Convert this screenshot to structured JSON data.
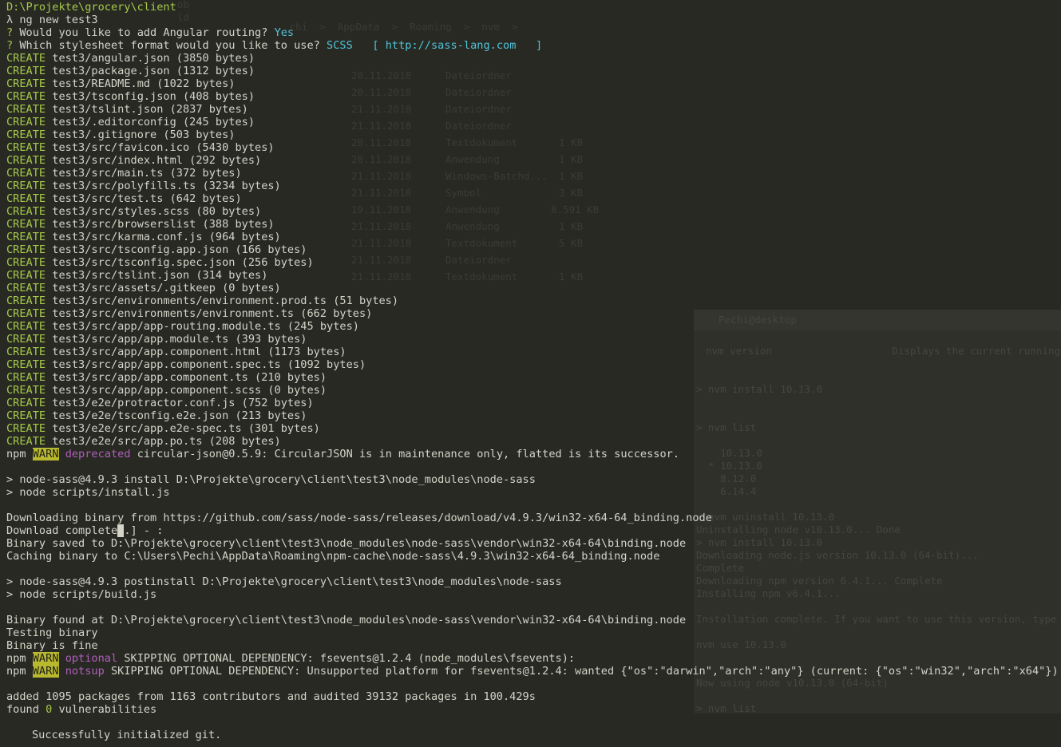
{
  "terminal": {
    "cwd": "D:\\Projekte\\grocery\\client",
    "command": "λ ng new test3",
    "questions": [
      {
        "mark": "?",
        "text": "Would you like to add Angular routing?",
        "answer": "Yes"
      },
      {
        "mark": "?",
        "text": "Which stylesheet format would you like to use?",
        "answer": "SCSS   [ http://sass-lang.com   ]"
      }
    ],
    "create_label": "CREATE",
    "created_files": [
      "test3/angular.json (3850 bytes)",
      "test3/package.json (1312 bytes)",
      "test3/README.md (1022 bytes)",
      "test3/tsconfig.json (408 bytes)",
      "test3/tslint.json (2837 bytes)",
      "test3/.editorconfig (245 bytes)",
      "test3/.gitignore (503 bytes)",
      "test3/src/favicon.ico (5430 bytes)",
      "test3/src/index.html (292 bytes)",
      "test3/src/main.ts (372 bytes)",
      "test3/src/polyfills.ts (3234 bytes)",
      "test3/src/test.ts (642 bytes)",
      "test3/src/styles.scss (80 bytes)",
      "test3/src/browserslist (388 bytes)",
      "test3/src/karma.conf.js (964 bytes)",
      "test3/src/tsconfig.app.json (166 bytes)",
      "test3/src/tsconfig.spec.json (256 bytes)",
      "test3/src/tslint.json (314 bytes)",
      "test3/src/assets/.gitkeep (0 bytes)",
      "test3/src/environments/environment.prod.ts (51 bytes)",
      "test3/src/environments/environment.ts (662 bytes)",
      "test3/src/app/app-routing.module.ts (245 bytes)",
      "test3/src/app/app.module.ts (393 bytes)",
      "test3/src/app/app.component.html (1173 bytes)",
      "test3/src/app/app.component.spec.ts (1092 bytes)",
      "test3/src/app/app.component.ts (210 bytes)",
      "test3/src/app/app.component.scss (0 bytes)",
      "test3/e2e/protractor.conf.js (752 bytes)",
      "test3/e2e/tsconfig.e2e.json (213 bytes)",
      "test3/e2e/src/app.e2e-spec.ts (301 bytes)",
      "test3/e2e/src/app.po.ts (208 bytes)"
    ],
    "npm_label": "npm",
    "warn_label": "WARN",
    "warn_deprecated": {
      "tag": "deprecated",
      "text": " circular-json@0.5.9: CircularJSON is in maintenance only, flatted is its successor."
    },
    "install_lines": [
      "> node-sass@4.9.3 install D:\\Projekte\\grocery\\client\\test3\\node_modules\\node-sass",
      "> node scripts/install.js"
    ],
    "download_line": "Downloading binary from https://github.com/sass/node-sass/releases/download/v4.9.3/win32-x64-64_binding.node",
    "download_complete_pre": "Download complete",
    "download_complete_cursor": " ",
    "download_complete_post": ".] - :",
    "binary_saved": "Binary saved to D:\\Projekte\\grocery\\client\\test3\\node_modules\\node-sass\\vendor\\win32-x64-64\\binding.node",
    "caching_binary": "Caching binary to C:\\Users\\Pechi\\AppData\\Roaming\\npm-cache\\node-sass\\4.9.3\\win32-x64-64_binding.node",
    "postinstall_lines": [
      "> node-sass@4.9.3 postinstall D:\\Projekte\\grocery\\client\\test3\\node_modules\\node-sass",
      "> node scripts/build.js"
    ],
    "binary_found": "Binary found at D:\\Projekte\\grocery\\client\\test3\\node_modules\\node-sass\\vendor\\win32-x64-64\\binding.node",
    "testing_binary": "Testing binary",
    "binary_fine": "Binary is fine",
    "warn_optional": {
      "tag": "optional",
      "text": " SKIPPING OPTIONAL DEPENDENCY: fsevents@1.2.4 (node_modules\\fsevents):"
    },
    "warn_notsup": {
      "tag": "notsup",
      "text": " SKIPPING OPTIONAL DEPENDENCY: Unsupported platform for fsevents@1.2.4: wanted {\"os\":\"darwin\",\"arch\":\"any\"} (current: {\"os\":\"win32\",\"arch\":\"x64\"})"
    },
    "added_line": "added 1095 packages from 1163 contributors and audited 39132 packages in 100.429s",
    "found_pre": "found ",
    "found_count": "0",
    "found_post": " vulnerabilities",
    "git_line": "Successfully initialized git."
  },
  "background": {
    "top_ghost": [
      "ob",
      "ld",
      "...chi  >  AppData  >  Roaming  >  nvm  >"
    ],
    "table_dates": [
      "20.11.2018",
      "20.11.2018",
      "21.11.2018",
      "21.11.2018",
      "20.11.2018",
      "20.11.2018",
      "21.11.2018",
      "21.11.2018",
      "19.11.2018",
      "21.11.2018",
      "21.11.2018",
      "21.11.2018",
      "21.11.2018"
    ],
    "table_types": [
      "Dateiordner",
      "Dateiordner",
      "Dateiordner",
      "Dateiordner",
      "Textdokument",
      "Anwendung",
      "Windows-Batchd...",
      "Symbol",
      "Anwendung",
      "Anwendung",
      "Textdokument",
      "Dateiordner",
      "Textdokument"
    ],
    "table_sizes": [
      "",
      "",
      "",
      "",
      "1 KB",
      "1 KB",
      "1 KB",
      "3 KB",
      "8.591 KB",
      "1 KB",
      "5 KB",
      "",
      "1 KB"
    ],
    "panel_title": "Pechi@desktop",
    "panel_lines": [
      "nvm version                    Displays the current running",
      "",
      "",
      "> nvm install 10.13.0",
      "",
      "> nvm list",
      "",
      "    10.13.0",
      "  * 10.13.0",
      "    8.12.0",
      "    6.14.4",
      "",
      "> nvm uninstall 10.13.0",
      "Uninstalling node v10.13.0... Done",
      "> nvm install 10.13.0",
      "Downloading node.js version 10.13.0 (64-bit)...",
      "Complete",
      "Downloading npm version 6.4.1... Complete",
      "Installing npm v6.4.1...",
      "",
      "Installation complete. If you want to use this version, type",
      "",
      "nvm use 10.13.0",
      "",
      "Now using node v10.13.0 (64-bit)",
      "",
      "> nvm list"
    ]
  }
}
